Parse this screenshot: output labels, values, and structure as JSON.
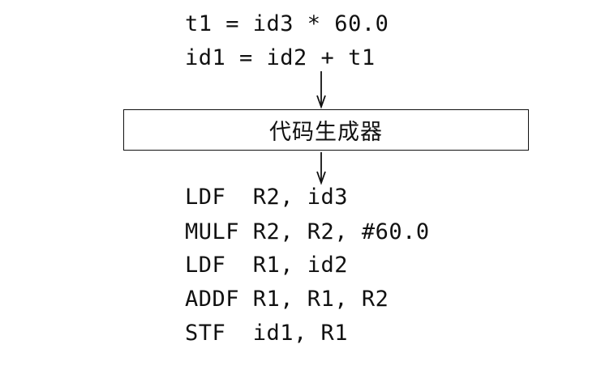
{
  "input_code": [
    "t1 = id3 * 60.0",
    "id1 = id2 + t1"
  ],
  "stage": {
    "label": "代码生成器"
  },
  "output_code": [
    "LDF  R2, id3",
    "MULF R2, R2, #60.0",
    "LDF  R1, id2",
    "ADDF R1, R1, R2",
    "STF  id1, R1"
  ]
}
